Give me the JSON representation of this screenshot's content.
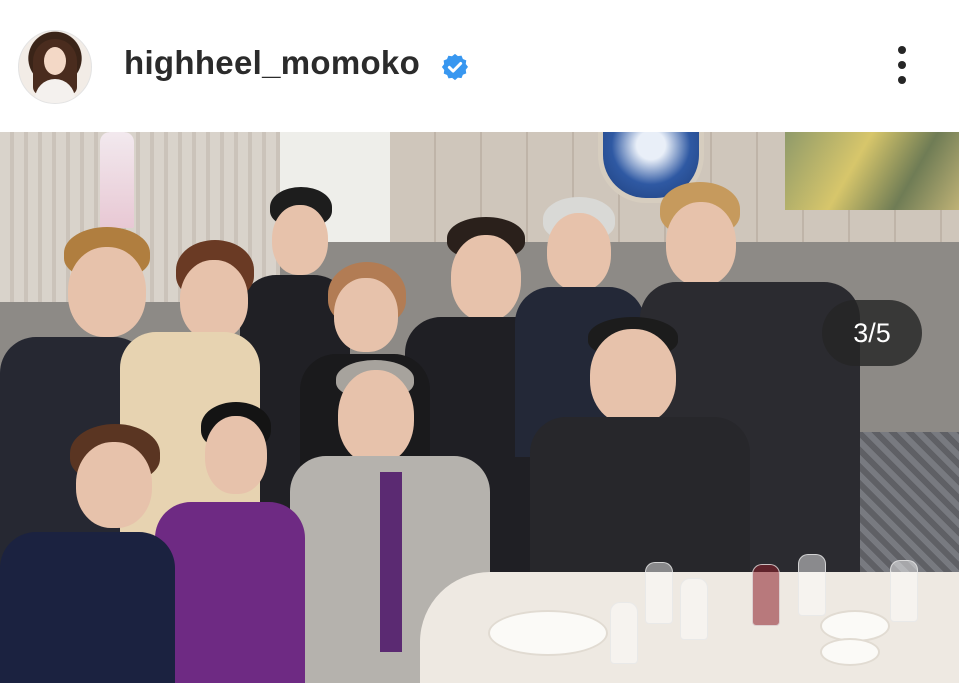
{
  "header": {
    "username": "highheel_momoko",
    "verified_icon": "verified-badge-icon",
    "more_icon": "more-options-icon"
  },
  "post": {
    "carousel_counter": "3/5",
    "image_description_icon": "photo"
  },
  "colors": {
    "verified_blue": "#3897f0",
    "text_dark": "#262626",
    "counter_bg": "#262626"
  }
}
